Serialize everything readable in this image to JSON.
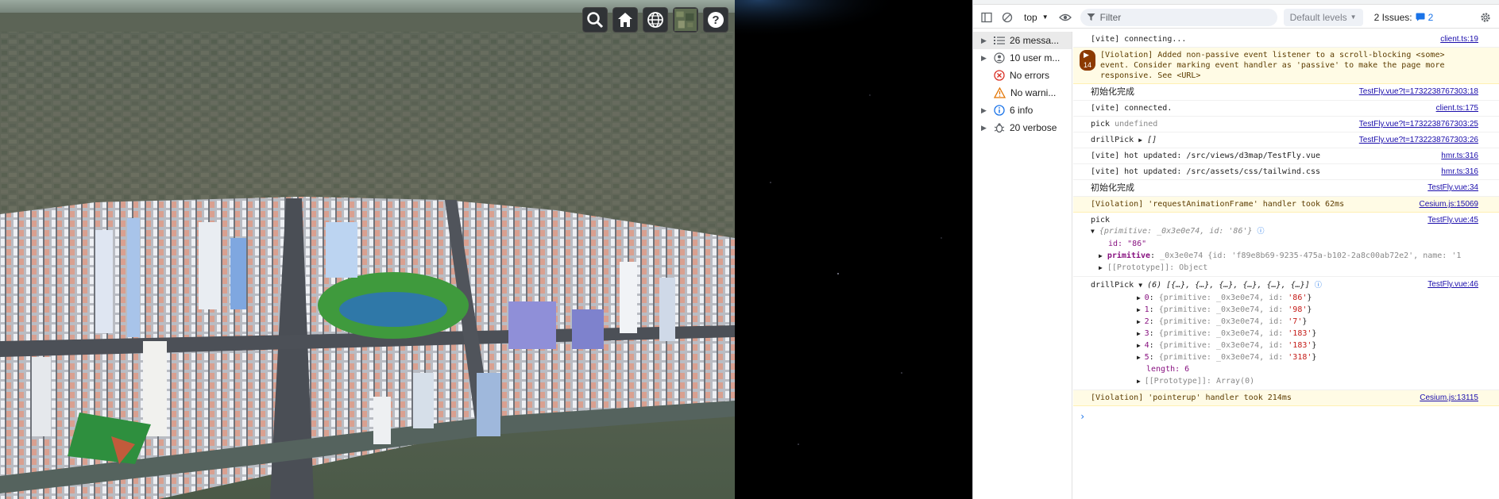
{
  "viewer": {
    "toolbar": [
      {
        "name": "search-icon",
        "label": "search"
      },
      {
        "name": "home-icon",
        "label": "home"
      },
      {
        "name": "globe-icon",
        "label": "scene mode"
      },
      {
        "name": "imagery-icon",
        "label": "base layer picker"
      },
      {
        "name": "help-icon",
        "label": "help"
      }
    ]
  },
  "devtools": {
    "context": "top",
    "filter_placeholder": "Filter",
    "levels": "Default levels",
    "issues_label": "2 Issues:",
    "issues_count": "2",
    "sidebar": [
      {
        "label": "26 messa...",
        "icon": "list-icon",
        "expandable": true,
        "selected": true
      },
      {
        "label": "10 user m...",
        "icon": "user-icon",
        "expandable": true,
        "selected": false
      },
      {
        "label": "No errors",
        "icon": "error-icon",
        "expandable": false,
        "selected": false
      },
      {
        "label": "No warni...",
        "icon": "warning-icon",
        "expandable": false,
        "selected": false
      },
      {
        "label": "6 info",
        "icon": "info-icon",
        "expandable": true,
        "selected": false
      },
      {
        "label": "20 verbose",
        "icon": "bug-icon",
        "expandable": true,
        "selected": false
      }
    ],
    "console": {
      "r1": {
        "text": "[vite] connecting...",
        "src": "client.ts:19"
      },
      "r2": {
        "badge": "14",
        "text": "[Violation] Added non-passive event listener to a scroll-blocking <some> event. Consider marking event handler as 'passive' to make the page more responsive. See <URL>"
      },
      "r3": {
        "text": "初始化完成",
        "src": "TestFly.vue?t=1732238767303:18"
      },
      "r4": {
        "text": "[vite] connected.",
        "src": "client.ts:175"
      },
      "r5": {
        "text": "pick",
        "value": "undefined",
        "src": "TestFly.vue?t=1732238767303:25"
      },
      "r6": {
        "text": "drillPick",
        "value": "[]",
        "src": "TestFly.vue?t=1732238767303:26"
      },
      "r7": {
        "text": "[vite] hot updated: /src/views/d3map/TestFly.vue",
        "src": "hmr.ts:316"
      },
      "r8": {
        "text": "[vite] hot updated: /src/assets/css/tailwind.css",
        "src": "hmr.ts:316"
      },
      "r9": {
        "text": "初始化完成",
        "src": "TestFly.vue:34"
      },
      "r10": {
        "text": "[Violation] 'requestAnimationFrame' handler took 62ms",
        "src": "Cesium.js:15069"
      },
      "r11": {
        "text": "pick",
        "src": "TestFly.vue:45",
        "summary": "{primitive: _0x3e0e74, id: '86'}",
        "id_line": "id: \"86\"",
        "prim_key": "primitive",
        "prim_val": "_0x3e0e74  {id: 'f89e8b69-9235-475a-b102-2a8c00ab72e2', name: '1",
        "proto": "[[Prototype]]: Object"
      },
      "r12": {
        "text": "drillPick",
        "src": "TestFly.vue:46",
        "summary": "(6) [{…}, {…}, {…}, {…}, {…}, {…}]",
        "items": [
          {
            "idx": "0",
            "id": "'86'"
          },
          {
            "idx": "1",
            "id": "'98'"
          },
          {
            "idx": "2",
            "id": "'7'"
          },
          {
            "idx": "3",
            "id": "'183'"
          },
          {
            "idx": "4",
            "id": "'183'"
          },
          {
            "idx": "5",
            "id": "'318'"
          }
        ],
        "item_prim": "{primitive: _0x3e0e74, id: ",
        "length_line": "length: 6",
        "proto": "[[Prototype]]: Array(0)"
      },
      "r13": {
        "text": "[Violation] 'pointerup' handler took 214ms",
        "src": "Cesium.js:13115"
      },
      "prompt": "›"
    }
  }
}
